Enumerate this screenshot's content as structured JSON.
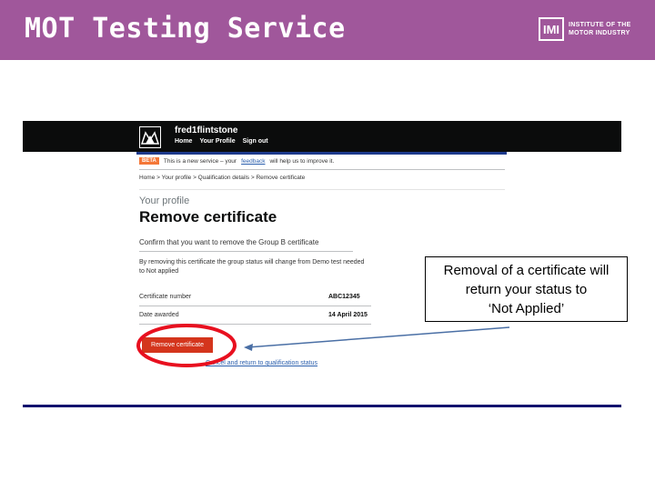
{
  "slide": {
    "title": "MOT Testing Service",
    "logo": {
      "mark": "IMI",
      "line1": "INSTITUTE OF THE",
      "line2": "MOTOR INDUSTRY"
    },
    "colors": {
      "banner": "#a0579b",
      "accent_rule": "#12126e",
      "highlight": "#e8101f"
    }
  },
  "screenshot": {
    "header": {
      "logo_icon": "crown-crest-icon",
      "user_name": "fred1flintstone",
      "nav": [
        "Home",
        "Your Profile",
        "Sign out"
      ]
    },
    "beta": {
      "tag": "BETA",
      "text_before": "This is a new service – your",
      "link": "feedback",
      "text_after": "will help us to improve it."
    },
    "breadcrumb": "Home  >  Your profile  >  Qualification details  >  Remove certificate",
    "caption": "Your profile",
    "heading": "Remove certificate",
    "confirm_text": "Confirm that you want to remove the Group B certificate",
    "warning_text": "By removing this certificate the group status will change from Demo test needed to Not applied",
    "details": [
      {
        "label": "Certificate number",
        "value": "ABC12345"
      },
      {
        "label": "Date awarded",
        "value": "14 April 2015"
      }
    ],
    "remove_button": "Remove certificate",
    "back_link": "Cancel and return to qualification status"
  },
  "callout": {
    "line1": "Removal of a certificate will",
    "line2": "return your status to",
    "line3": "‘Not Applied’"
  }
}
